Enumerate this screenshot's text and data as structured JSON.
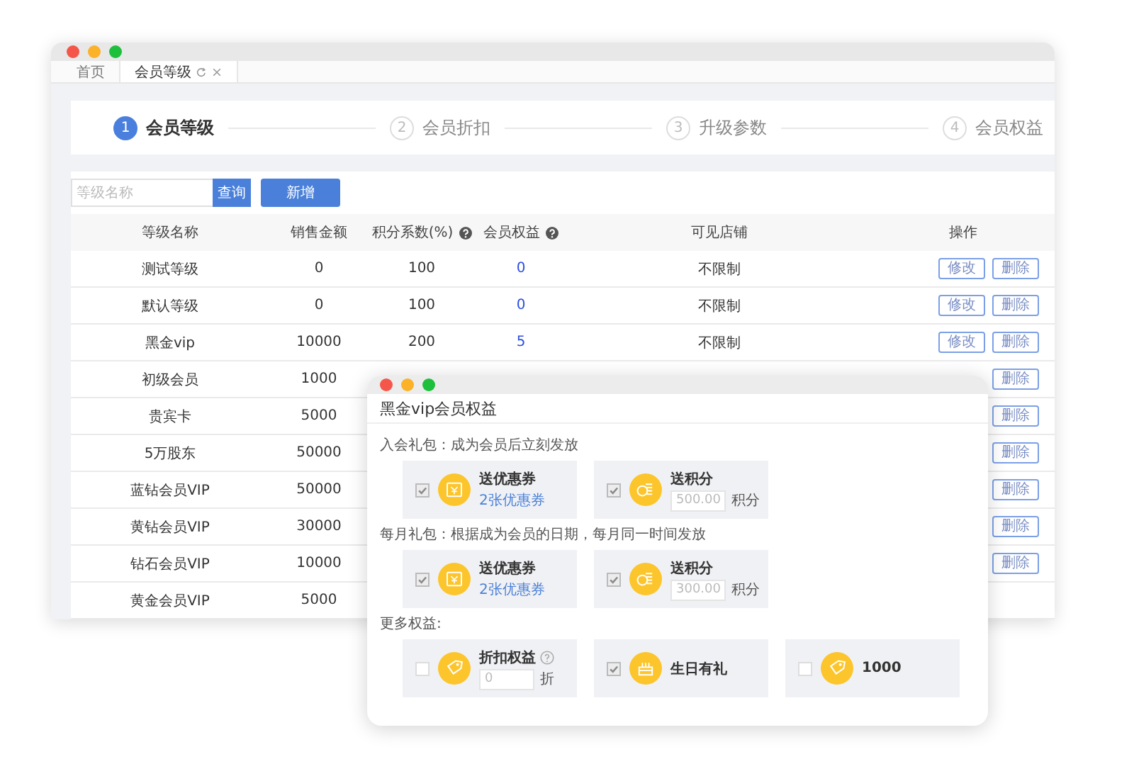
{
  "main_window": {
    "tabs": [
      {
        "label": "首页",
        "selected": false,
        "closable": false
      },
      {
        "label": "会员等级",
        "selected": true,
        "closable": true
      }
    ],
    "steps": [
      {
        "number": "1",
        "label": "会员等级",
        "selected": true
      },
      {
        "number": "2",
        "label": "会员折扣",
        "selected": false
      },
      {
        "number": "3",
        "label": "升级参数",
        "selected": false
      },
      {
        "number": "4",
        "label": "会员权益",
        "selected": false
      }
    ],
    "search": {
      "placeholder": "等级名称",
      "button": "查询"
    },
    "add_button": "新增",
    "table": {
      "columns": [
        {
          "label": "等级名称",
          "help": false
        },
        {
          "label": "销售金额",
          "help": false
        },
        {
          "label": "积分系数(%)",
          "help": true
        },
        {
          "label": "会员权益",
          "help": true
        },
        {
          "label": "可见店铺",
          "help": false
        },
        {
          "label": "操作",
          "help": false
        }
      ],
      "rows": [
        {
          "name": "测试等级",
          "amount": "0",
          "points": "100",
          "benefits": "0",
          "stores": "不限制",
          "actions": [
            {
              "kind": "edit",
              "label": "修改"
            },
            {
              "kind": "delete",
              "label": "删除"
            }
          ]
        },
        {
          "name": "默认等级",
          "amount": "0",
          "points": "100",
          "benefits": "0",
          "stores": "不限制",
          "actions": [
            {
              "kind": "edit",
              "label": "修改"
            },
            {
              "kind": "delete",
              "label": "删除"
            }
          ]
        },
        {
          "name": "黑金vip",
          "amount": "10000",
          "points": "200",
          "benefits": "5",
          "stores": "不限制",
          "actions": [
            {
              "kind": "edit",
              "label": "修改"
            },
            {
              "kind": "delete",
              "label": "删除"
            }
          ]
        },
        {
          "name": "初级会员",
          "amount": "1000",
          "actions": [
            {
              "kind": "delete",
              "label": "删除"
            }
          ]
        },
        {
          "name": "贵宾卡",
          "amount": "5000",
          "actions": [
            {
              "kind": "delete",
              "label": "删除"
            }
          ]
        },
        {
          "name": "5万股东",
          "amount": "50000",
          "actions": [
            {
              "kind": "delete",
              "label": "删除"
            }
          ]
        },
        {
          "name": "蓝钻会员VIP",
          "amount": "50000",
          "actions": [
            {
              "kind": "delete",
              "label": "删除"
            }
          ]
        },
        {
          "name": "黄钻会员VIP",
          "amount": "30000",
          "actions": [
            {
              "kind": "delete",
              "label": "删除"
            }
          ]
        },
        {
          "name": "钻石会员VIP",
          "amount": "10000",
          "actions": [
            {
              "kind": "delete",
              "label": "删除"
            }
          ]
        },
        {
          "name": "黄金会员VIP",
          "amount": "5000"
        }
      ]
    }
  },
  "popup": {
    "title": "黑金vip会员权益",
    "sections": [
      {
        "label": "入会礼包：成为会员后立刻发放",
        "items": [
          {
            "kind": "coupon",
            "checked": true,
            "disabled": true,
            "title": "送优惠券",
            "link": "2张优惠券"
          },
          {
            "kind": "points",
            "checked": true,
            "disabled": true,
            "title": "送积分",
            "value": "500.00",
            "unit": "积分"
          }
        ]
      },
      {
        "label": "每月礼包：根据成为会员的日期，每月同一时间发放",
        "items": [
          {
            "kind": "coupon",
            "checked": true,
            "disabled": true,
            "title": "送优惠券",
            "link": "2张优惠券"
          },
          {
            "kind": "points",
            "checked": true,
            "disabled": true,
            "title": "送积分",
            "value": "300.00",
            "unit": "积分"
          }
        ]
      },
      {
        "label": "更多权益:",
        "items": [
          {
            "kind": "discount",
            "checked": false,
            "disabled": false,
            "title": "折扣权益",
            "value": "0",
            "unit": "折"
          },
          {
            "kind": "birthday",
            "checked": true,
            "disabled": true,
            "title": "生日有礼"
          },
          {
            "kind": "amount",
            "checked": false,
            "disabled": false,
            "title": "1000"
          }
        ]
      }
    ]
  }
}
